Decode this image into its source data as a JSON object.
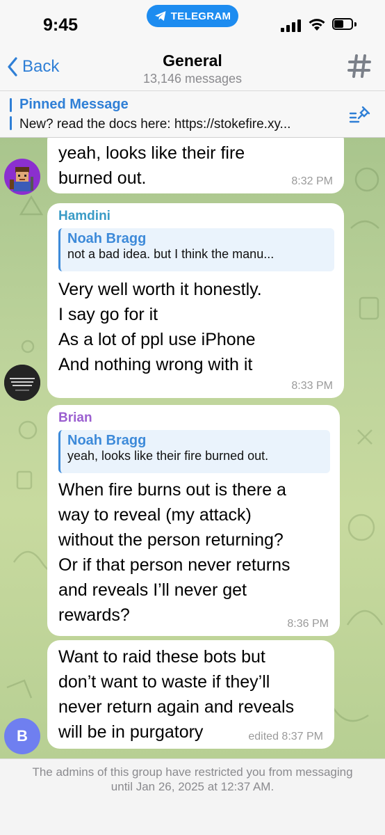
{
  "status_bar": {
    "time": "9:45",
    "app_pill": "TELEGRAM"
  },
  "nav": {
    "back_label": "Back",
    "title": "General",
    "subtitle": "13,146 messages"
  },
  "pinned": {
    "title": "Pinned Message",
    "text": "New? read the docs here: https://stokefire.xy..."
  },
  "messages": [
    {
      "text_lines": [
        "yeah, looks like their fire",
        "burned out."
      ],
      "time": "8:32 PM"
    },
    {
      "sender": "Hamdini",
      "sender_color": "#3a9bc6",
      "reply": {
        "name": "Noah Bragg",
        "text": "not a bad idea. but I think the manu..."
      },
      "text_lines": [
        "Very well worth it honestly.",
        "I say go for it",
        "As a lot of ppl use iPhone",
        "And nothing wrong with it"
      ],
      "time": "8:33 PM"
    },
    {
      "sender": "Brian",
      "sender_color": "#9b5fd0",
      "reply": {
        "name": "Noah Bragg",
        "text": "yeah, looks like their fire burned out."
      },
      "text_lines": [
        "When fire burns out is there a",
        "way to reveal (my attack)",
        "without the person returning?",
        "Or if that person never returns",
        "and reveals I’ll never get",
        "rewards?"
      ],
      "time": "8:36 PM"
    },
    {
      "text_lines": [
        "Want to raid these bots but",
        "don’t want to waste if they’ll",
        "never return again and reveals",
        "will be in purgatory"
      ],
      "time": "edited 8:37 PM"
    }
  ],
  "avatar_b_letter": "B",
  "footer": {
    "text": "The admins of this group have restricted you from messaging until Jan 26, 2025 at 12:37 AM."
  },
  "colors": {
    "accent": "#2f7fd6",
    "telegram_pill": "#1d8cf0",
    "avatar_b": "#6f7ff0"
  },
  "icons": [
    "chevron-left-icon",
    "hashtag-icon",
    "pin-list-icon",
    "telegram-logo-icon",
    "cellular-signal-icon",
    "wifi-icon",
    "battery-icon"
  ]
}
